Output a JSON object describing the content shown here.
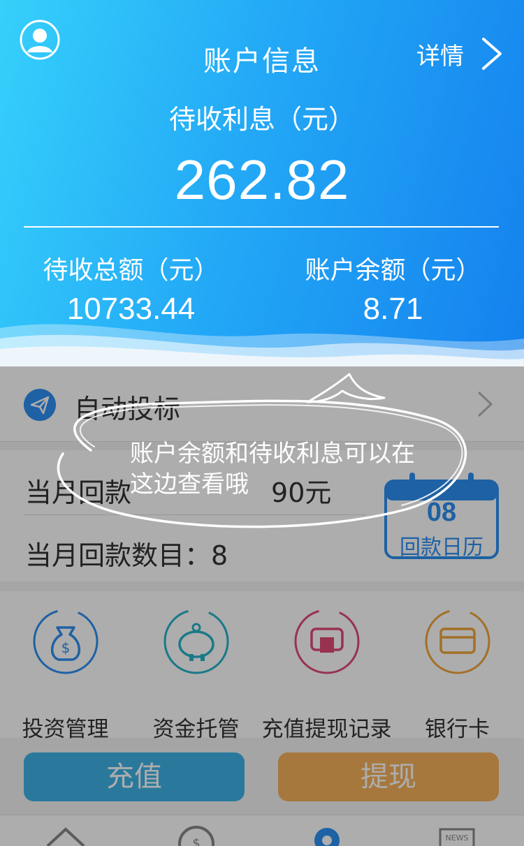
{
  "header": {
    "title": "账户信息",
    "detail_label": "详情",
    "interest_label": "待收利息（元）",
    "interest_value": "262.82",
    "total_label": "待收总额（元）",
    "total_value": "10733.44",
    "balance_label": "账户余额（元）",
    "balance_value": "8.71"
  },
  "auto_bid": {
    "label": "自动投标"
  },
  "monthly": {
    "repay_amount_text": "当月回款",
    "repay_amount_tail": "90元",
    "repay_count_text": "当月回款数目：8",
    "calendar_day": "08",
    "calendar_label": "回款日历"
  },
  "features": [
    {
      "label": "投资管理",
      "icon": "money-bag-icon"
    },
    {
      "label": "资金托管",
      "icon": "piggy-bank-icon"
    },
    {
      "label": "充值提现记录",
      "icon": "record-icon"
    },
    {
      "label": "银行卡",
      "icon": "bank-card-icon"
    }
  ],
  "buttons": {
    "recharge": "充值",
    "withdraw": "提现"
  },
  "tip": {
    "text": "账户余额和待收利息可以在这边查看哦"
  },
  "colors": {
    "primary": "#2d8ff2",
    "header_start": "#36d0fb",
    "header_end": "#1481ee",
    "recharge": "#3fb3e6",
    "withdraw": "#f5b25b"
  }
}
